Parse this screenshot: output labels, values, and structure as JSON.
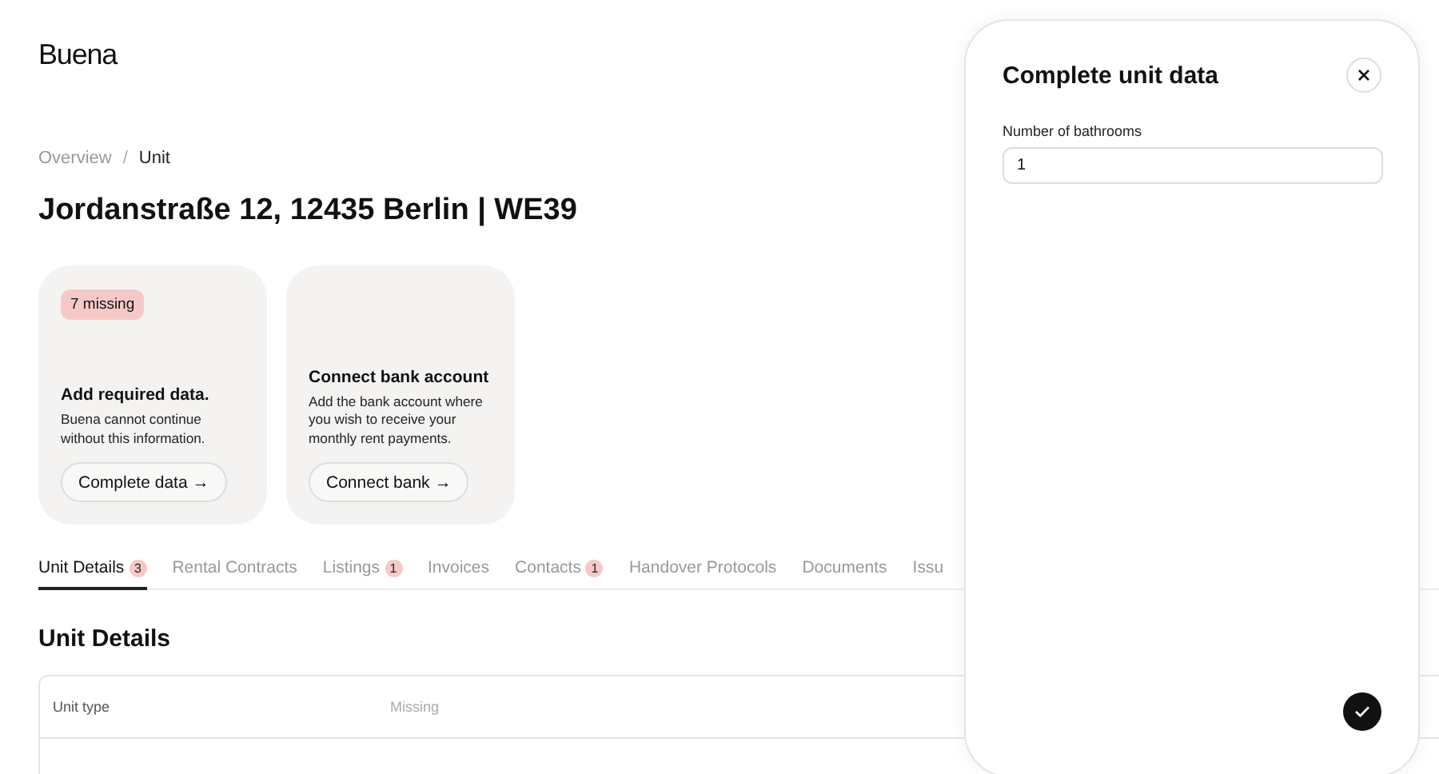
{
  "logo": "Buena",
  "breadcrumb": [
    {
      "label": "Overview",
      "current": false
    },
    {
      "label": "Unit",
      "current": true
    }
  ],
  "breadcrumb_separator": "/",
  "title": "Jordanstraße 12, 12435 Berlin | WE39",
  "cards": [
    {
      "badge": "7 missing",
      "heading": "Add required data.",
      "text": "Buena cannot continue without this information.",
      "button": "Complete data →"
    },
    {
      "heading": "Connect bank account",
      "text": "Add the bank account where you wish to receive your monthly rent payments.",
      "button": "Connect bank →"
    }
  ],
  "tabs": [
    {
      "label": "Unit Details",
      "count": "3",
      "selected": true
    },
    {
      "label": "Rental Contracts",
      "selected": false
    },
    {
      "label": "Listings",
      "count": "1",
      "selected": false
    },
    {
      "label": "Invoices",
      "selected": false
    },
    {
      "label": "Contacts",
      "count": "1",
      "selected": false
    },
    {
      "label": "Handover Protocols",
      "selected": false
    },
    {
      "label": "Documents",
      "selected": false
    },
    {
      "label": "Issu",
      "selected": false
    }
  ],
  "section_title": "Unit Details",
  "table": {
    "rows": [
      {
        "label": "Unit type",
        "value": "Missing",
        "missing": true
      }
    ]
  },
  "panel": {
    "title": "Complete unit data",
    "field": {
      "label": "Number of bathrooms",
      "value": "1"
    }
  }
}
